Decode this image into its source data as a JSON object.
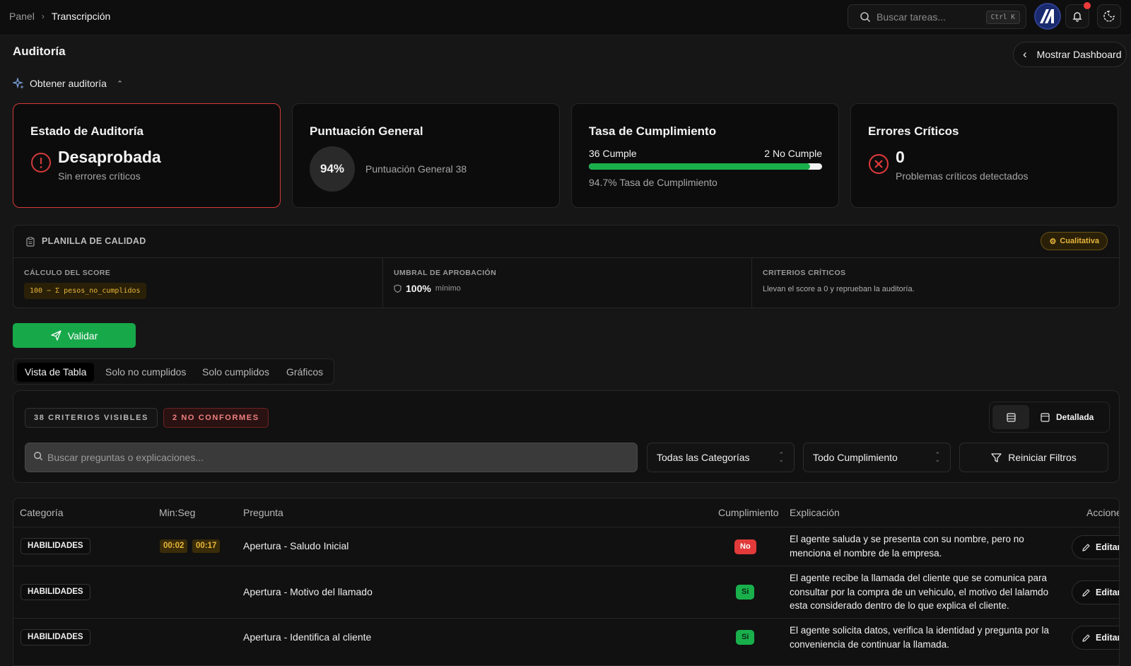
{
  "breadcrumb": {
    "root": "Panel",
    "current": "Transcripción"
  },
  "topbar": {
    "search_placeholder": "Buscar tareas...",
    "shortcut": "Ctrl K"
  },
  "page": {
    "title": "Auditoría",
    "dashboard_button": "Mostrar Dashboard",
    "get_audit": "Obtener auditoría"
  },
  "cards": {
    "estado": {
      "title": "Estado de Auditoría",
      "value": "Desaprobada",
      "sub": "Sin errores críticos"
    },
    "puntuacion": {
      "title": "Puntuación General",
      "value": "94%",
      "sub": "Puntuación General 38"
    },
    "tasa": {
      "title": "Tasa de Cumplimiento",
      "cumple": "36 Cumple",
      "no_cumple": "2 No Cumple",
      "progress": 0.947,
      "sub": "94.7% Tasa de Cumplimiento"
    },
    "errores": {
      "title": "Errores Críticos",
      "value": "0",
      "sub": "Problemas críticos detectados"
    }
  },
  "planilla": {
    "title": "PLANILLA DE CALIDAD",
    "badge": "Cualitativa",
    "calculo_label": "CÁLCULO DEL SCORE",
    "calculo_formula": "100 − Σ pesos_no_cumplidos",
    "umbral_label": "UMBRAL DE APROBACIÓN",
    "umbral_value": "100%",
    "umbral_suffix": "mínimo",
    "criticos_label": "CRITERIOS CRÍTICOS",
    "criticos_text": "Llevan el score a 0 y reprueban la auditoría."
  },
  "validar": "Validar",
  "tabs": [
    "Vista de Tabla",
    "Solo no cumplidos",
    "Solo cumplidos",
    "Gráficos"
  ],
  "filters": {
    "visible": "38 CRITERIOS VISIBLES",
    "no_conformes": "2 NO CONFORMES",
    "detallada": "Detallada",
    "search_placeholder": "Buscar preguntas o explicaciones...",
    "categorias": "Todas las Categorías",
    "cumplimiento": "Todo Cumplimiento",
    "reset": "Reiniciar Filtros"
  },
  "table": {
    "headers": [
      "Categoría",
      "Min:Seg",
      "Pregunta",
      "Cumplimiento",
      "Explicación",
      "Acciones"
    ],
    "edit_label": "Editar",
    "rows": [
      {
        "categoria": "HABILIDADES",
        "t1": "00:02",
        "t2": "00:17",
        "pregunta": "Apertura - Saludo Inicial",
        "cumple": "No",
        "explicacion": "El agente saluda y se presenta con su nombre, pero no menciona el nombre de la empresa."
      },
      {
        "categoria": "HABILIDADES",
        "t1": "",
        "t2": "",
        "pregunta": "Apertura - Motivo del llamado",
        "cumple": "Si",
        "explicacion": "El agente recibe la llamada del cliente que se comunica para consultar por la compra de un vehiculo, el motivo del lalamdo esta considerado dentro de lo que explica el cliente."
      },
      {
        "categoria": "HABILIDADES",
        "t1": "",
        "t2": "",
        "pregunta": "Apertura - Identifica al cliente",
        "cumple": "Si",
        "explicacion": "El agente solicita datos, verifica la identidad y pregunta por la conveniencia de continuar la llamada."
      }
    ]
  },
  "colors": {
    "accent_green": "#17a84a",
    "danger": "#e23a3a",
    "warning": "#e9b63a",
    "background": "#161616"
  }
}
